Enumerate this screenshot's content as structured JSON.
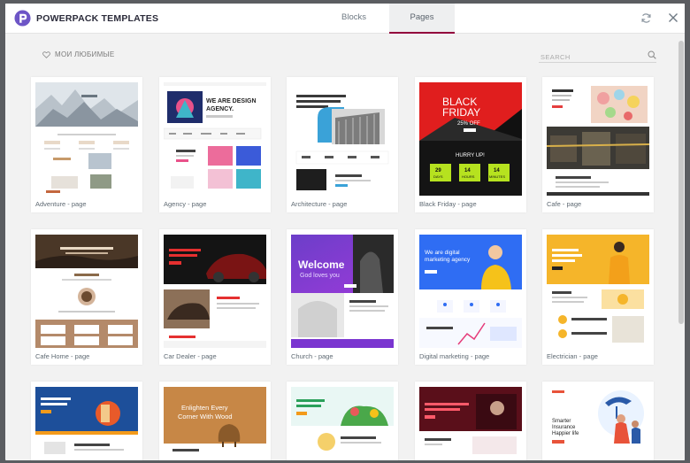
{
  "header": {
    "brand": "POWERPACK TEMPLATES",
    "tabs": [
      {
        "label": "Blocks",
        "active": false
      },
      {
        "label": "Pages",
        "active": true
      }
    ]
  },
  "toolbar": {
    "favorites_label": "МОИ ЛЮБИМЫЕ",
    "search_placeholder": "SEARCH"
  },
  "templates": {
    "items": [
      {
        "name": "Adventure - page"
      },
      {
        "name": "Agency - page",
        "headline": "WE ARE DESIGN AGENCY."
      },
      {
        "name": "Architecture - page"
      },
      {
        "name": "Black Friday - page",
        "headline": "BLACK FRIDAY",
        "subhead": "25% OFF",
        "cta": "HURRY UP!",
        "timer": [
          "DAYS",
          "HOURS",
          "MINUTES"
        ],
        "timer_values": [
          "29",
          "14",
          "14"
        ]
      },
      {
        "name": "Cafe - page"
      },
      {
        "name": "Cafe Home - page"
      },
      {
        "name": "Car Dealer - page"
      },
      {
        "name": "Church - page",
        "headline": "Welcome",
        "subhead": "God loves you"
      },
      {
        "name": "Digital marketing - page",
        "headline": "We are digital marketing agency"
      },
      {
        "name": "Electrician - page"
      },
      {
        "name": ""
      },
      {
        "name": "",
        "headline": "Enlighten Every Corner With Wood"
      },
      {
        "name": ""
      },
      {
        "name": ""
      },
      {
        "name": "",
        "headline": "Smarter Insurance Happier life"
      }
    ]
  },
  "colors": {
    "accent": "#93003c",
    "brand_purple": "#6d55c6"
  }
}
